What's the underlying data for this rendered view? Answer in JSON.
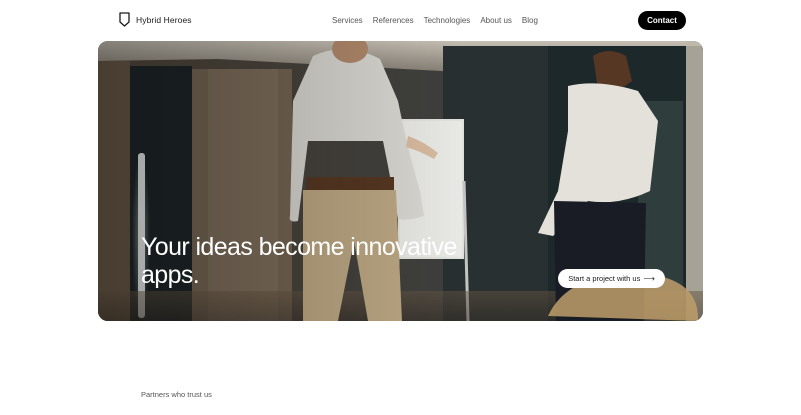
{
  "brand": {
    "name": "Hybrid Heroes",
    "logo_icon": "shield-outline-icon"
  },
  "nav": {
    "items": [
      {
        "label": "Services"
      },
      {
        "label": "References"
      },
      {
        "label": "Technologies"
      },
      {
        "label": "About us"
      },
      {
        "label": "Blog"
      }
    ],
    "contact_label": "Contact"
  },
  "hero": {
    "title": "Your ideas become innovative apps.",
    "cta_label": "Start a project with us",
    "cta_icon": "arrow-right-icon",
    "cta_arrow": "⟶"
  },
  "partners": {
    "label": "Partners who trust us"
  },
  "colors": {
    "accent": "#000000",
    "text": "#1a1a1a",
    "muted": "#555555",
    "background": "#ffffff"
  }
}
